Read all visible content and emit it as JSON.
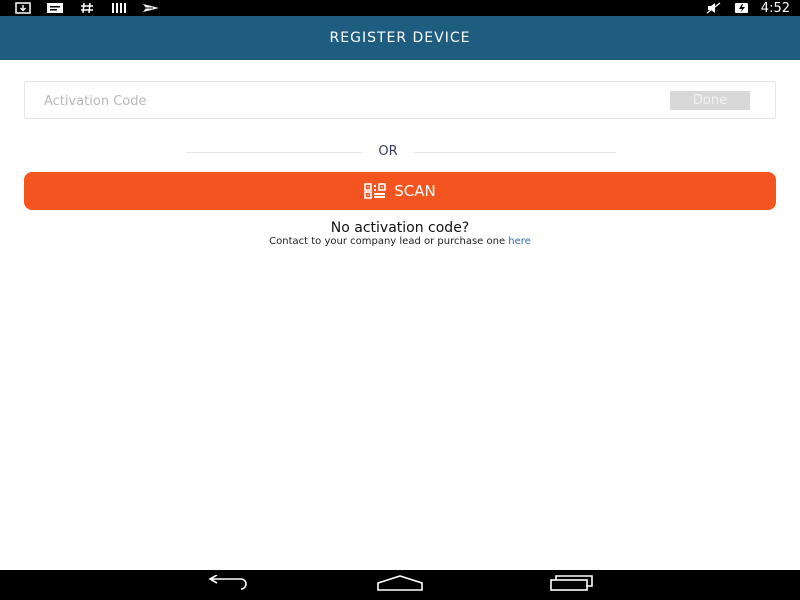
{
  "status_bar": {
    "time": "4:52",
    "left_icons": [
      "download-icon",
      "message-icon",
      "hash-icon",
      "barcode-icon",
      "send-icon"
    ],
    "right_icons": [
      "mute-icon",
      "battery-charging-icon"
    ]
  },
  "app_bar": {
    "title": "REGISTER DEVICE",
    "color": "#1e5c80"
  },
  "activation": {
    "placeholder": "Activation Code",
    "value": "",
    "done_label": "Done"
  },
  "divider": {
    "label": "OR"
  },
  "scan": {
    "label": "SCAN",
    "icon": "qr-code-icon",
    "color": "#f4541f"
  },
  "help": {
    "question": "No activation code?",
    "contact_prefix": "Contact to your company lead or purchase one ",
    "link_label": "here"
  },
  "nav_bar": {
    "buttons": [
      "back-icon",
      "home-icon",
      "recent-apps-icon"
    ]
  }
}
